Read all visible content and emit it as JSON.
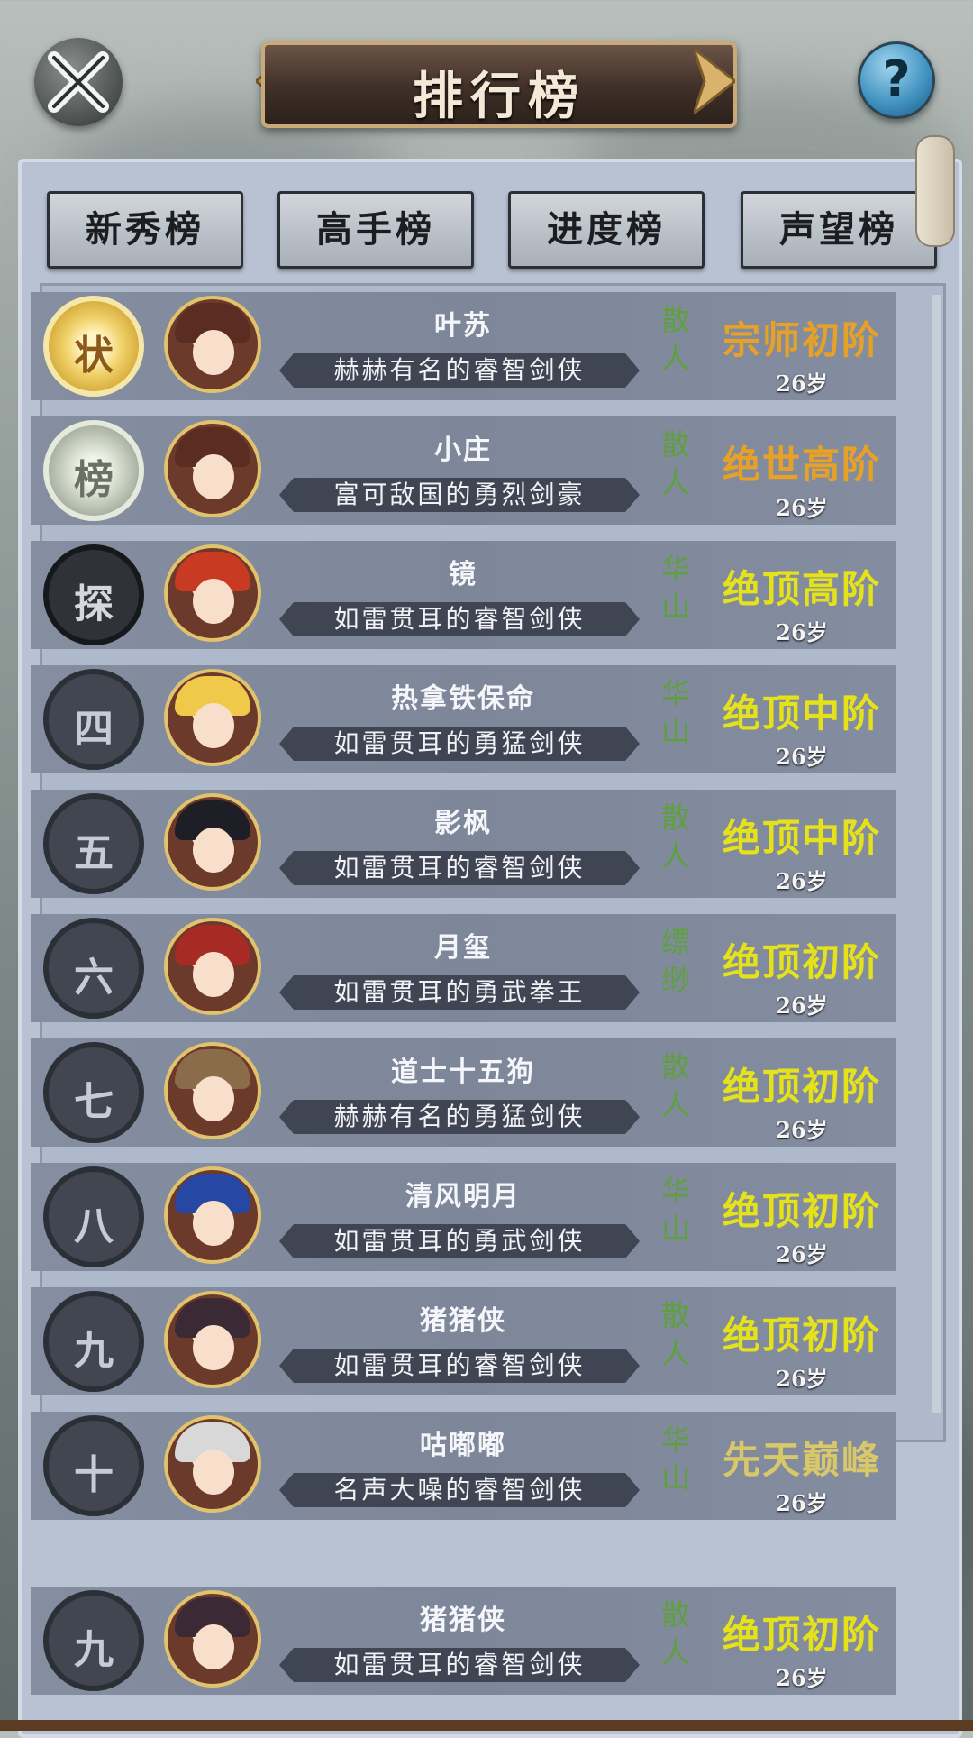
{
  "header": {
    "title": "排行榜",
    "help_symbol": "?"
  },
  "tabs": [
    "新秀榜",
    "高手榜",
    "进度榜",
    "声望榜"
  ],
  "entries": [
    {
      "rank": "状",
      "name": "叶苏",
      "title": "赫赫有名的睿智剑侠",
      "sect": "散人",
      "realm": "宗师初阶",
      "realm_color": "#e7a126",
      "age": "26岁"
    },
    {
      "rank": "榜",
      "name": "小庄",
      "title": "富可敌国的勇烈剑豪",
      "sect": "散人",
      "realm": "绝世高阶",
      "realm_color": "#e7a126",
      "age": "26岁"
    },
    {
      "rank": "探",
      "name": "镜",
      "title": "如雷贯耳的睿智剑侠",
      "sect": "华山",
      "realm": "绝顶高阶",
      "realm_color": "#e6e21a",
      "age": "26岁"
    },
    {
      "rank": "四",
      "name": "热拿铁保命",
      "title": "如雷贯耳的勇猛剑侠",
      "sect": "华山",
      "realm": "绝顶中阶",
      "realm_color": "#e6e21a",
      "age": "26岁"
    },
    {
      "rank": "五",
      "name": "影枫",
      "title": "如雷贯耳的睿智剑侠",
      "sect": "散人",
      "realm": "绝顶中阶",
      "realm_color": "#e6e21a",
      "age": "26岁"
    },
    {
      "rank": "六",
      "name": "月玺",
      "title": "如雷贯耳的勇武拳王",
      "sect": "缥缈",
      "realm": "绝顶初阶",
      "realm_color": "#e6e21a",
      "age": "26岁"
    },
    {
      "rank": "七",
      "name": "道士十五狗",
      "title": "赫赫有名的勇猛剑侠",
      "sect": "散人",
      "realm": "绝顶初阶",
      "realm_color": "#e6e21a",
      "age": "26岁"
    },
    {
      "rank": "八",
      "name": "清风明月",
      "title": "如雷贯耳的勇武剑侠",
      "sect": "华山",
      "realm": "绝顶初阶",
      "realm_color": "#e6e21a",
      "age": "26岁"
    },
    {
      "rank": "九",
      "name": "猪猪侠",
      "title": "如雷贯耳的睿智剑侠",
      "sect": "散人",
      "realm": "绝顶初阶",
      "realm_color": "#e6e21a",
      "age": "26岁"
    },
    {
      "rank": "十",
      "name": "咕嘟嘟",
      "title": "名声大噪的睿智剑侠",
      "sect": "华山",
      "realm": "先天巅峰",
      "realm_color": "#d9c86a",
      "age": "26岁"
    }
  ],
  "my_entry": {
    "rank": "九",
    "name": "猪猪侠",
    "title": "如雷贯耳的睿智剑侠",
    "sect": "散人",
    "realm": "绝顶初阶",
    "realm_color": "#e6e21a",
    "age": "26岁"
  }
}
